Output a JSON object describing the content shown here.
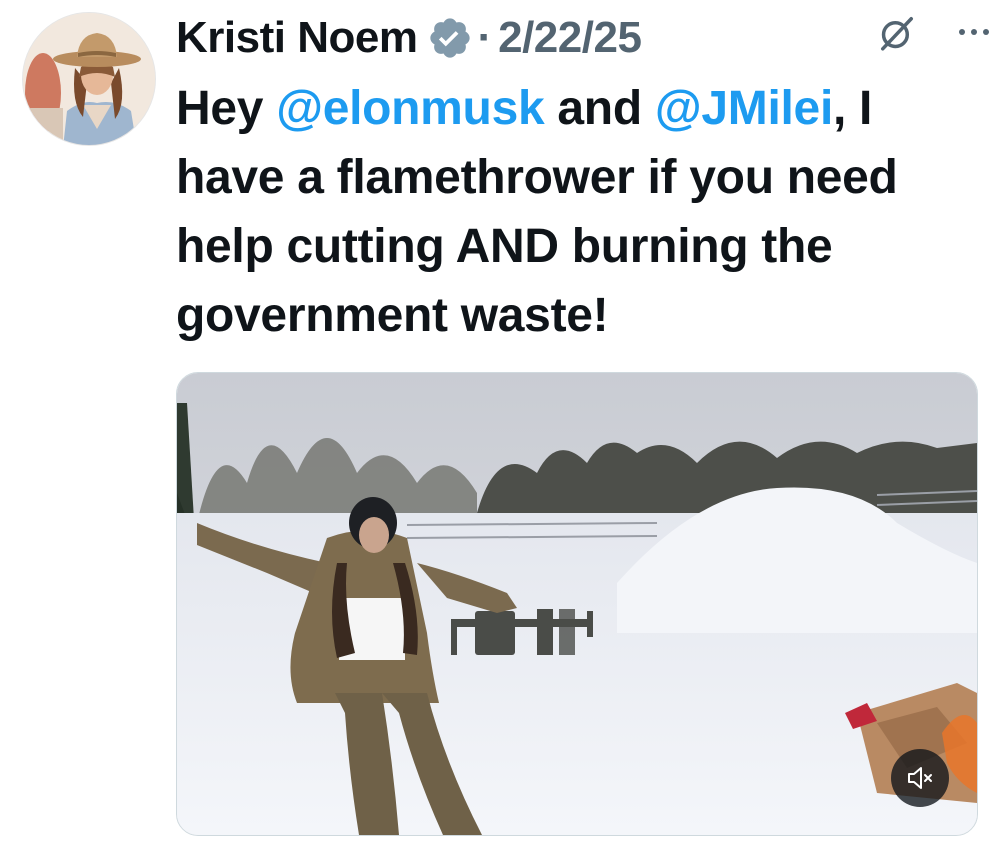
{
  "tweet": {
    "author_name": "Kristi Noem",
    "date": "2/22/25",
    "separator": "·",
    "text_parts": [
      {
        "text": "Hey ",
        "type": "plain"
      },
      {
        "text": "@elonmusk",
        "type": "mention"
      },
      {
        "text": " and ",
        "type": "plain"
      },
      {
        "text": "@JMilei",
        "type": "mention"
      },
      {
        "text": ", I have a flamethrower if you need help cutting AND burning the government waste!",
        "type": "plain"
      }
    ]
  },
  "icons": {
    "verified": "verified-badge-icon",
    "grok": "grok-icon",
    "more": "more-options-icon",
    "mute": "muted-speaker-icon"
  },
  "colors": {
    "mention": "#1d9bf0",
    "secondary_text": "#536471",
    "verified_badge": "#829aab"
  },
  "media": {
    "kind": "video",
    "muted": true
  }
}
